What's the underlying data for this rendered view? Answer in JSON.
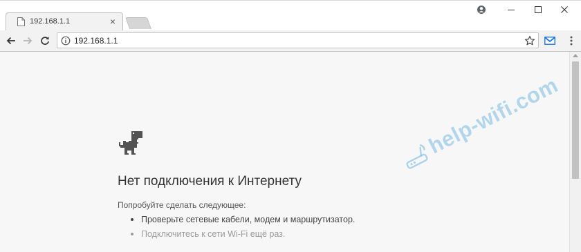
{
  "browser": {
    "tab": {
      "title": "192.168.1.1",
      "close_label": "×"
    },
    "address_bar": {
      "url": "192.168.1.1"
    },
    "accent_color": "#1a73e8"
  },
  "page": {
    "error_title": "Нет подключения к Интернету",
    "suggest_label": "Попробуйте сделать следующее:",
    "suggestions": [
      "Проверьте сетевые кабели, модем и маршрутизатор.",
      "Подключитесь к сети Wi-Fi ещё раз."
    ]
  },
  "watermark": {
    "text": "help-wifi.com"
  }
}
